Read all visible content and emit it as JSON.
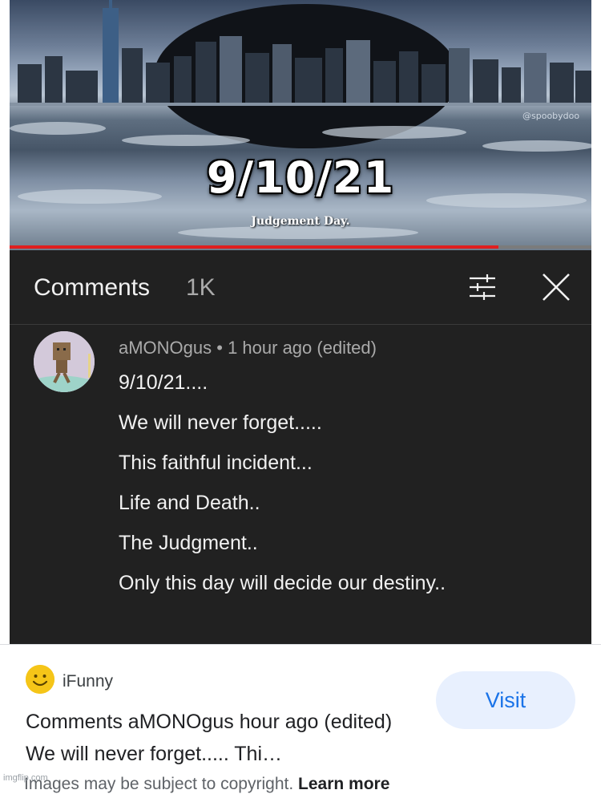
{
  "video": {
    "title": "9/10/21",
    "subtitle": "Judgement Day.",
    "credit": "@spoobydoo",
    "progress_fraction": 0.84
  },
  "comments_panel": {
    "title": "Comments",
    "count": "1K",
    "icons": {
      "filter": "sliders-icon",
      "close": "close-icon"
    }
  },
  "comment": {
    "author": "aMONOgus",
    "meta": "aMONOgus • 1 hour ago (edited)",
    "lines": [
      "9/10/21....",
      "We will never forget.....",
      "This faithful incident...",
      "Life and Death..",
      "The Judgment..",
      "Only this day will decide our destiny.."
    ]
  },
  "card": {
    "source_name": "iFunny",
    "source_icon": "smiley-icon",
    "visit_label": "Visit",
    "title": "Comments aMONOgus hour ago (edited) We will never forget..... Thi…",
    "copyright_text": "Images may be subject to copyright.",
    "learn_more": "Learn more",
    "watermark": "imgflip.com"
  },
  "colors": {
    "panel_bg": "#212121",
    "progress_red": "#e01f1f",
    "visit_bg": "#e8f0fe",
    "visit_text": "#1a73e8",
    "icon_yellow": "#f5c518"
  }
}
